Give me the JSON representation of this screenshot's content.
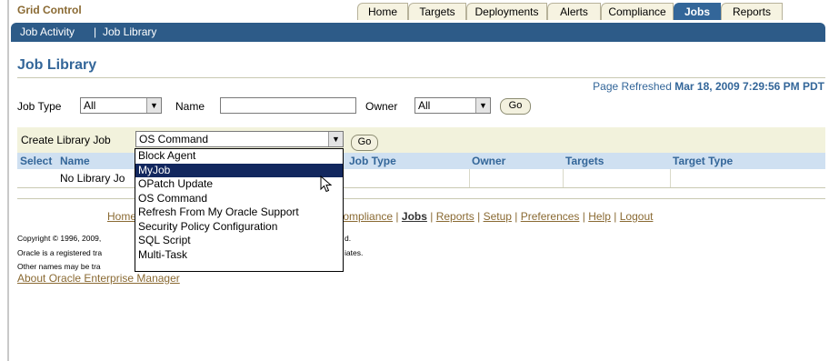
{
  "app": {
    "title": "Grid Control"
  },
  "tabs": [
    {
      "label": "Home",
      "active": false
    },
    {
      "label": "Targets",
      "active": false
    },
    {
      "label": "Deployments",
      "active": false
    },
    {
      "label": "Alerts",
      "active": false
    },
    {
      "label": "Compliance",
      "active": false
    },
    {
      "label": "Jobs",
      "active": true
    },
    {
      "label": "Reports",
      "active": false
    }
  ],
  "subnav": {
    "job_activity": "Job Activity",
    "separator": "|",
    "job_library": "Job Library"
  },
  "page": {
    "title": "Job Library",
    "refreshed_label": "Page Refreshed",
    "refreshed_time": "Mar 18, 2009 7:29:56 PM PDT"
  },
  "filters": {
    "job_type_label": "Job Type",
    "job_type_value": "All",
    "name_label": "Name",
    "name_value": "",
    "owner_label": "Owner",
    "owner_value": "All",
    "go_label": "Go"
  },
  "create": {
    "label": "Create Library Job",
    "value": "OS Command",
    "go_label": "Go",
    "options": [
      "Block Agent",
      "MyJob",
      "OPatch Update",
      "OS Command",
      "Refresh From My Oracle Support",
      "Security Policy Configuration",
      "SQL Script",
      "Multi-Task"
    ],
    "highlighted_option": "MyJob"
  },
  "table": {
    "headers": {
      "select": "Select",
      "name": "Name",
      "job_type": "Job Type",
      "owner": "Owner",
      "targets": "Targets",
      "target_type": "Target Type"
    },
    "empty_message": "No Library Jo"
  },
  "footer": {
    "links": {
      "home": "Home",
      "compliance": "Compliance",
      "jobs": "Jobs",
      "reports": "Reports",
      "setup": "Setup",
      "preferences": "Preferences",
      "help": "Help",
      "logout": "Logout"
    },
    "separator": "|",
    "copyright_1a": "Copyright © 1996, 2009,",
    "copyright_1b": "d.",
    "copyright_2a": "Oracle is a registered tra",
    "copyright_2b": "iates.",
    "copyright_3a": "Other names may be tra",
    "about": "About Oracle Enterprise Manager"
  },
  "colors": {
    "brand": "#336699",
    "link": "#8a6a33",
    "subnav": "#2d5b88",
    "highlight": "#12275e"
  }
}
